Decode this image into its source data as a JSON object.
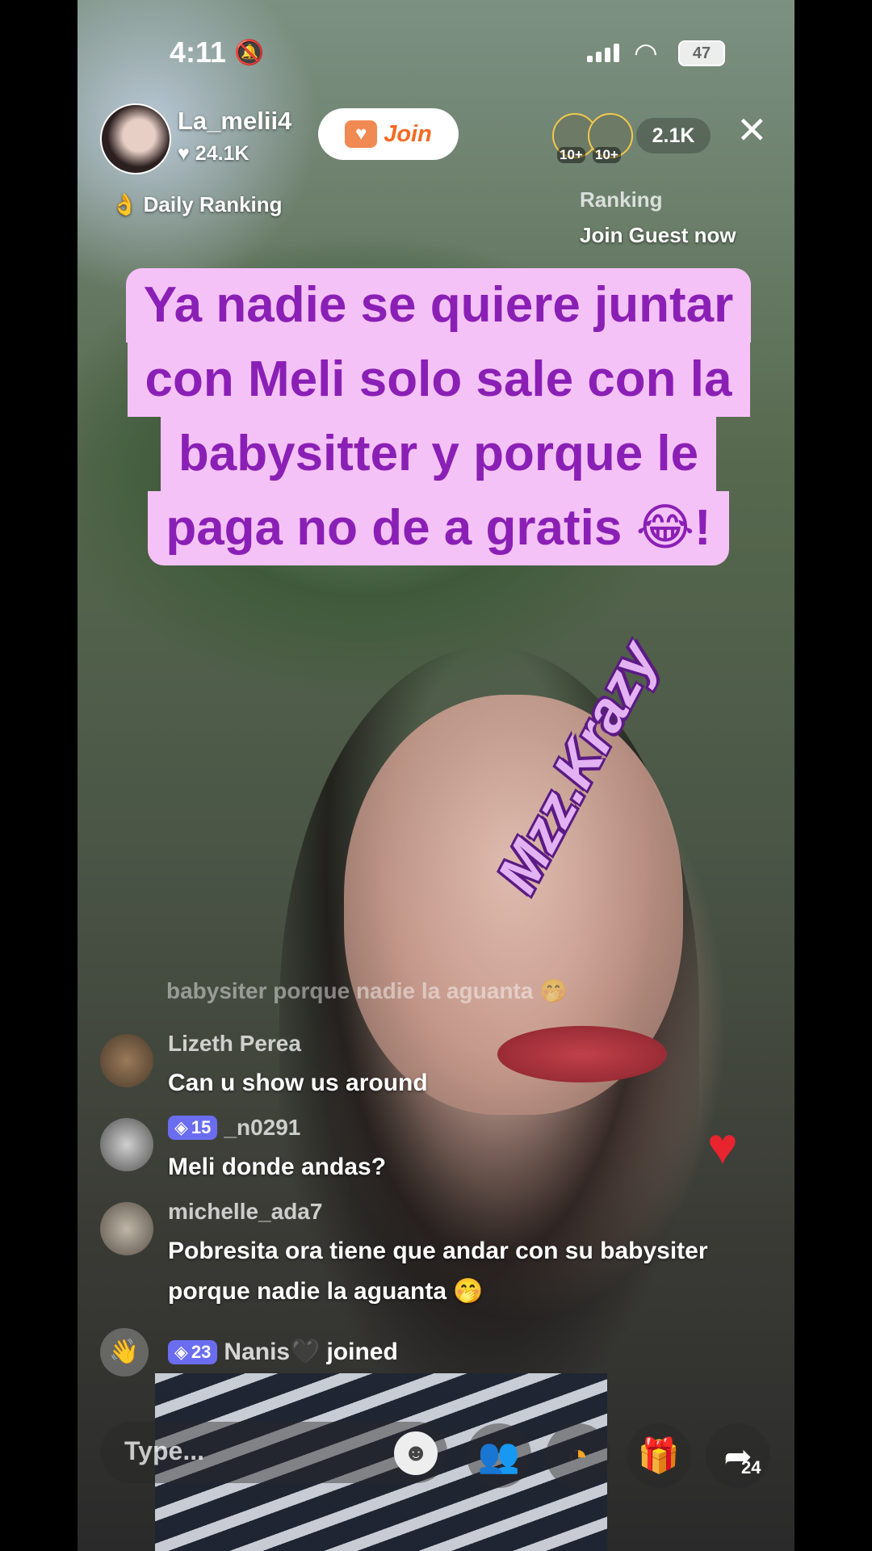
{
  "status_bar": {
    "time": "4:11",
    "battery": "47"
  },
  "host": {
    "name": "La_melii4",
    "likes": "24.1K",
    "join_label": "Join",
    "daily_ranking": "Daily Ranking"
  },
  "viewers": {
    "badges": [
      "10+",
      "10+"
    ],
    "count": "2.1K",
    "ranking_label": "Ranking",
    "guest_label": "Join Guest now"
  },
  "caption": {
    "lines": [
      "Ya nadie se quiere juntar",
      "con Meli solo sale con la",
      "babysitter y porque le",
      "paga no de a gratis 😂!"
    ]
  },
  "watermark": "Mzz.Krazy",
  "chat": {
    "faded_message": "babysiter porque nadie la aguanta 🤭",
    "comments": [
      {
        "user": "Lizeth Perea",
        "level": "",
        "text": "Can u show us around"
      },
      {
        "user": "_n0291",
        "level": "15",
        "text": "Meli donde andas?"
      },
      {
        "user": "michelle_ada7",
        "level": "",
        "text": "Pobresita ora tiene que andar con su babysiter porque nadie la aguanta 🤭"
      }
    ],
    "joined": {
      "level": "23",
      "user": "Nanis🖤",
      "action": "joined"
    }
  },
  "bottom_bar": {
    "placeholder": "Type...",
    "share_count": "24"
  },
  "colors": {
    "caption_bg": "#f5c2f7",
    "caption_text": "#8a1fb5",
    "join_text": "#f26a22",
    "level_badge": "#6b6df0",
    "heart": "#e8242f"
  }
}
